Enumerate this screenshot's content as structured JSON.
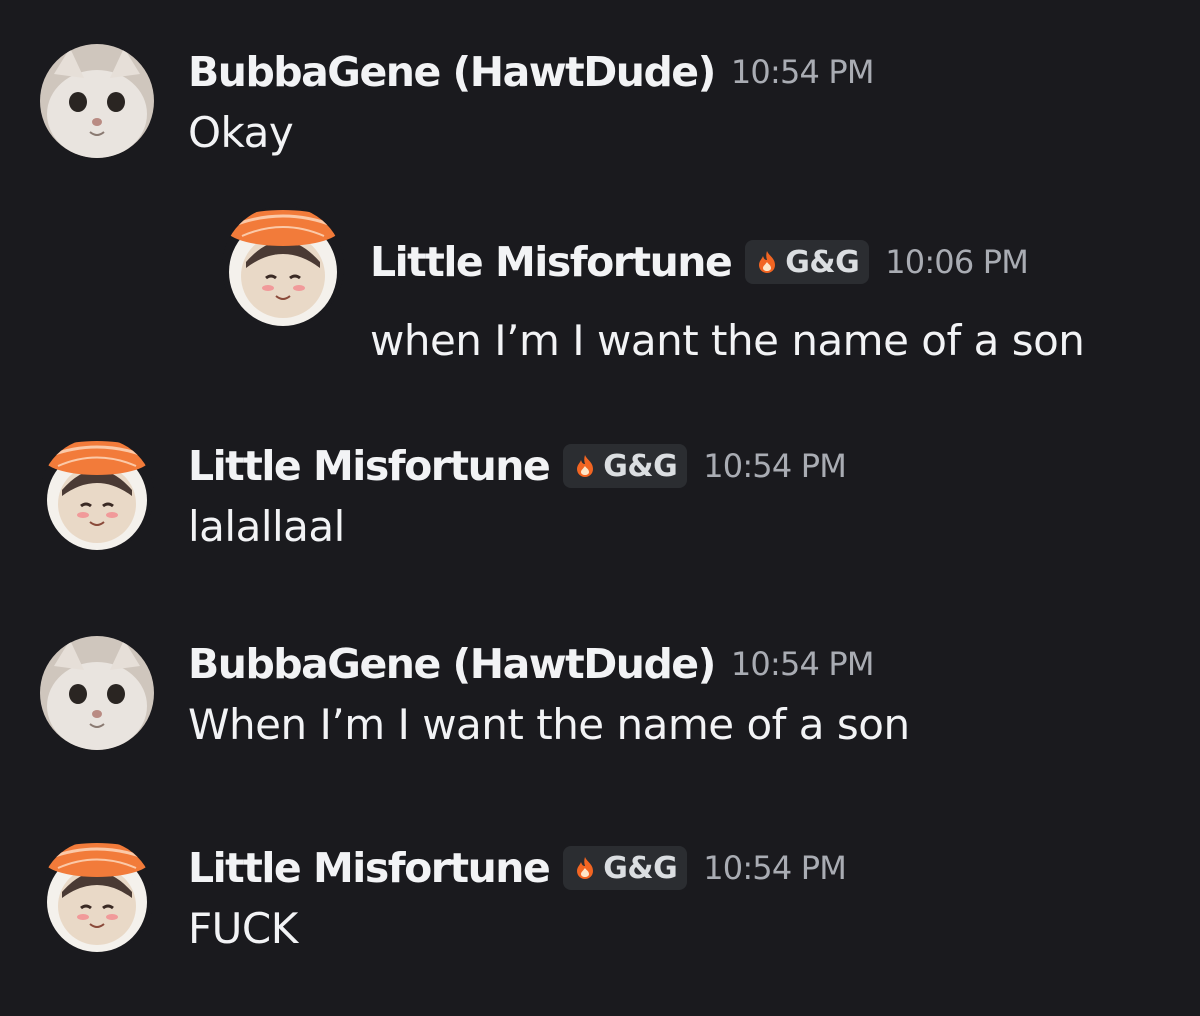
{
  "messages": [
    {
      "username": "BubbaGene (HawtDude)",
      "timestamp": "10:54 PM",
      "text": "Okay"
    },
    {
      "username": "Little Misfortune",
      "tag": "G&G",
      "timestamp": "10:54 PM",
      "text": "lalallaal"
    },
    {
      "username": "BubbaGene (HawtDude)",
      "timestamp": "10:54 PM",
      "text": "When I’m I want the name of a son"
    },
    {
      "username": "Little Misfortune",
      "tag": "G&G",
      "timestamp": "10:54 PM",
      "text": "FUCK"
    }
  ],
  "reply": {
    "username": "Little Misfortune",
    "tag": "G&G",
    "timestamp": "10:06 PM",
    "text": "when I’m I want the name of a son"
  },
  "colors": {
    "background": "#1a1a1e",
    "username": "#f2f3f5",
    "timestamp": "#a9acb3",
    "tag_background": "#2b2d31",
    "flame": "#f26522"
  },
  "icons": {
    "cat_avatar": "cat-avatar",
    "sushi_avatar": "sushi-avatar",
    "tag_icon": "flame-icon"
  }
}
